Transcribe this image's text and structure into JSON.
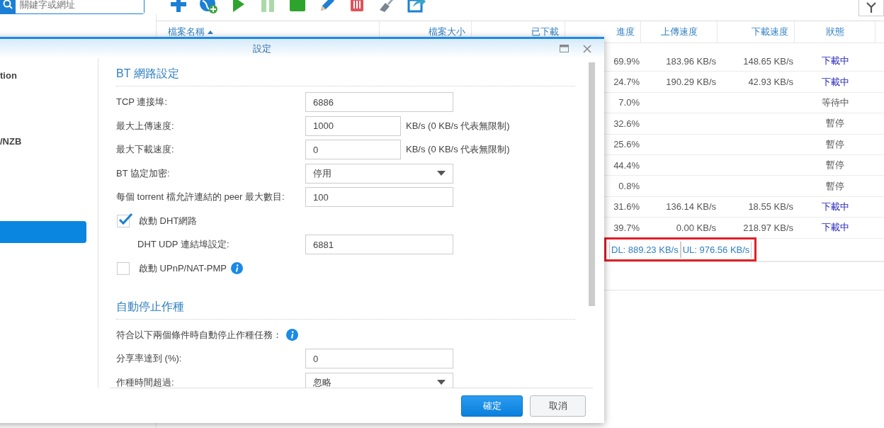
{
  "search": {
    "placeholder": "關鍵字或網址"
  },
  "toolbar": [
    {
      "kind": "add",
      "disabled": false
    },
    {
      "kind": "add_url",
      "disabled": false
    },
    {
      "kind": "resume",
      "disabled": false
    },
    {
      "kind": "pause",
      "disabled": true
    },
    {
      "kind": "stop",
      "disabled": false
    },
    {
      "kind": "edit",
      "disabled": false
    },
    {
      "kind": "delete",
      "disabled": false
    },
    {
      "kind": "clear",
      "disabled": false
    },
    {
      "kind": "share",
      "disabled": false
    }
  ],
  "table": {
    "columns": [
      {
        "label": "檔案名稱",
        "sorted": true
      },
      {
        "label": "檔案大小",
        "sorted": false
      },
      {
        "label": "已下載",
        "sorted": false
      },
      {
        "label": "進度",
        "sorted": false
      },
      {
        "label": "上傳速度",
        "sorted": false
      },
      {
        "label": "下載速度",
        "sorted": false
      },
      {
        "label": "狀態",
        "sorted": false
      }
    ],
    "rows": [
      {
        "progress": "69.9%",
        "upload": "183.96 KB/s",
        "download": "148.65 KB/s",
        "status": "下載中",
        "active": true
      },
      {
        "progress": "24.7%",
        "upload": "190.29 KB/s",
        "download": "42.93 KB/s",
        "status": "下載中",
        "active": true
      },
      {
        "progress": "7.0%",
        "status": "等待中",
        "active": false
      },
      {
        "progress": "32.6%",
        "status": "暫停",
        "active": false
      },
      {
        "progress": "25.6%",
        "status": "暫停",
        "active": false
      },
      {
        "progress": "44.4%",
        "status": "暫停",
        "active": false
      },
      {
        "progress": "0.8%",
        "status": "暫停",
        "active": false
      },
      {
        "progress": "31.6%",
        "upload": "136.14 KB/s",
        "download": "18.55 KB/s",
        "status": "下載中",
        "active": true
      },
      {
        "progress": "39.7%",
        "upload": "0.00 KB/s",
        "download": "218.97 KB/s",
        "status": "下載中",
        "active": true
      }
    ],
    "footer": {
      "dl": "DL: 889.23 KB/s",
      "ul": "UL: 976.56 KB/s",
      "highlighted": true
    }
  },
  "dialog": {
    "title": "設定",
    "nav": [
      {
        "label": "tion",
        "selected": false
      },
      {
        "label": "/NZB",
        "selected": false
      },
      {
        "selected": true
      }
    ],
    "sections": [
      {
        "title": "BT 網路設定",
        "rows": [
          {
            "kind": "input",
            "label": "TCP 連接埠:",
            "value": "6886"
          },
          {
            "kind": "input",
            "label": "最大上傳速度:",
            "value": "1000",
            "unit": "KB/s (0 KB/s 代表無限制)"
          },
          {
            "kind": "input",
            "label": "最大下載速度:",
            "value": "0",
            "unit": "KB/s (0 KB/s 代表無限制)"
          },
          {
            "kind": "select",
            "label": "BT 協定加密:",
            "value": "停用"
          },
          {
            "kind": "input",
            "label": "每個 torrent 檔允許連結的 peer 最大數目:",
            "value": "100"
          },
          {
            "kind": "checkbox",
            "label": "啟動 DHT網路",
            "checked": true
          },
          {
            "kind": "input",
            "label": "DHT UDP 連結埠設定:",
            "value": "6881",
            "indented": true
          },
          {
            "kind": "checkbox",
            "label": "啟動 UPnP/NAT-PMP",
            "checked": false,
            "info": true
          }
        ]
      },
      {
        "title": "自動停止作種",
        "rows": [
          {
            "kind": "note",
            "label": "符合以下兩個條件時自動停止作種任務：",
            "info": true
          },
          {
            "kind": "input",
            "label": "分享率達到 (%):",
            "value": "0"
          },
          {
            "kind": "select",
            "label": "作種時間超過:",
            "value": "忽略"
          }
        ]
      }
    ],
    "buttons": [
      {
        "label": "確定",
        "primary": true
      },
      {
        "label": "取消",
        "primary": false
      }
    ]
  }
}
